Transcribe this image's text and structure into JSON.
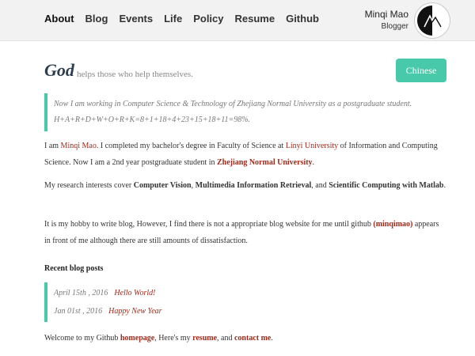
{
  "nav": {
    "items": [
      "About",
      "Blog",
      "Events",
      "Life",
      "Policy",
      "Resume",
      "Github"
    ]
  },
  "profile": {
    "name": "Minqi Mao",
    "role": "Blogger"
  },
  "motto": {
    "strong": "God",
    "rest": "helps those who help themselves."
  },
  "language_button": "Chinese",
  "quote": {
    "line1": "Now I am working in Computer Science & Technology of Zhejiang Normal University as a postgraduate student.",
    "line2": "H+A+R+D+W+O+R+K=8+1+18+4+23+15+18+11=98%."
  },
  "paragraph1": {
    "t1": "I am ",
    "name": "Minqi Mao",
    "t2": ". I completed my bachelor's degree in Faculty of Science at ",
    "linyi": "Linyi University",
    "t3": " of Information and Computing Science. Now I am a 2nd year postgraduate student in ",
    "zjnu": "Zhejiang Normal University",
    "t4": "."
  },
  "paragraph2": {
    "t1": "My research interests cover ",
    "b1": "Computer Vision",
    "t2": ", ",
    "b2": "Multimedia Information Retrieval",
    "t3": ", and ",
    "b3": "Scientific Computing with Matlab",
    "t4": "."
  },
  "paragraph3": {
    "t1": "It is my hobby to write blog, However, I find there is not a appropriate blog website for me until github ",
    "link": "(minqimao)",
    "t2": " appears in front of me although there are still amounts of dissatisfaction."
  },
  "recent": {
    "title": "Recent blog posts",
    "posts": [
      {
        "date": "April 15th , 2016",
        "title": "Hello World!"
      },
      {
        "date": "Jan 01st , 2016",
        "title": "Happy New Year"
      }
    ]
  },
  "footer_line": {
    "t1": "Welcome to my Github ",
    "homepage": "homepage",
    "t2": ", Here's my ",
    "resume": "resume",
    "t3": ", and ",
    "contact": "contact me",
    "t4": "."
  },
  "colors": {
    "accent": "#48c9a9",
    "link": "#a02a1a"
  }
}
